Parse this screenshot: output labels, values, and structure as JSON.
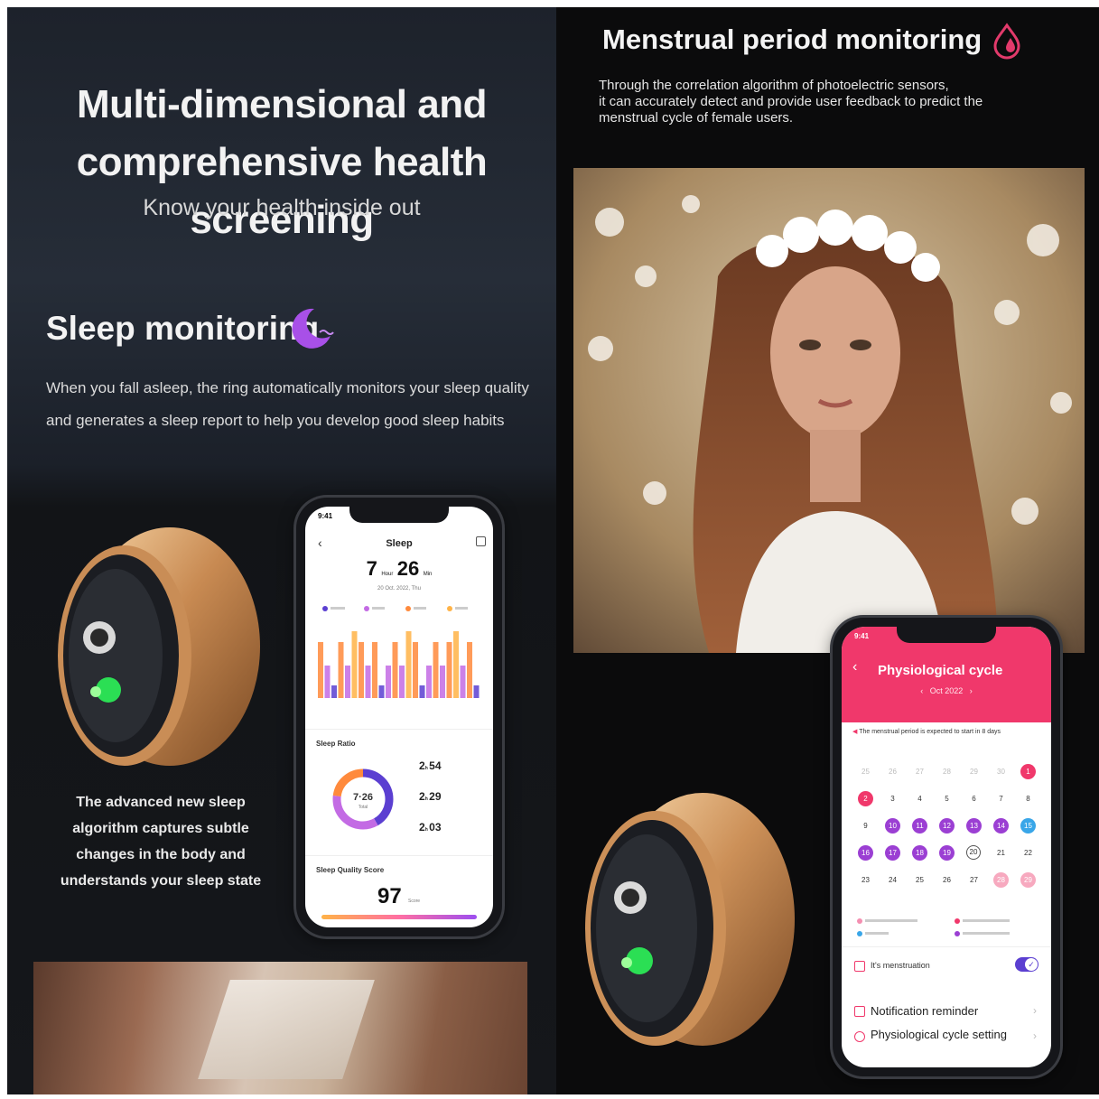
{
  "left": {
    "headline_line1": "Multi-dimensional and",
    "headline_line2": "comprehensive health screening",
    "subheadline": "Know your health inside out",
    "sleep_title": "Sleep monitoring",
    "sleep_desc_line1": "When you fall asleep, the ring automatically monitors your sleep quality",
    "sleep_desc_line2": "and generates a sleep report to help you develop good sleep habits",
    "caption_lines": [
      "The advanced new sleep",
      "algorithm captures subtle",
      "changes in the body and",
      "understands your sleep state"
    ]
  },
  "sleep_app": {
    "status_time": "9:41",
    "title": "Sleep",
    "total_hours": "7",
    "hours_unit": "Hour",
    "total_minutes": "26",
    "minutes_unit": "Min",
    "date": "20 Oct. 2022, Thu",
    "ratio_title": "Sleep Ratio",
    "ratio_center": "7·26",
    "ratio_center_sub": "Total",
    "stage_rows": [
      {
        "hours": "2",
        "minutes": "54"
      },
      {
        "hours": "2",
        "minutes": "29"
      },
      {
        "hours": "2",
        "minutes": "03"
      }
    ],
    "score_title": "Sleep Quality Score",
    "score": "97",
    "score_unit": "Score",
    "colors": {
      "deep": "#5b3fd1",
      "light": "#c36be4",
      "awake": "#ff8a3c",
      "rem": "#ffb347"
    }
  },
  "right": {
    "menstrual_title": "Menstrual period monitoring",
    "menstrual_desc_line1": "Through the correlation algorithm of photoelectric sensors,",
    "menstrual_desc_line2": "it can accurately detect and provide user feedback to predict the",
    "menstrual_desc_line3": "menstrual cycle of female users."
  },
  "cycle_app": {
    "status_time": "9:41",
    "title": "Physiological cycle",
    "month": "Oct 2022",
    "notice": "The menstrual period is expected to start in 8 days",
    "calendar_rows": [
      [
        "25",
        "26",
        "27",
        "28",
        "29",
        "30",
        "1"
      ],
      [
        "2",
        "3",
        "4",
        "5",
        "6",
        "7",
        "8"
      ],
      [
        "9",
        "10",
        "11",
        "12",
        "13",
        "14",
        "15"
      ],
      [
        "16",
        "17",
        "18",
        "19",
        "20",
        "21",
        "22"
      ],
      [
        "23",
        "24",
        "25",
        "26",
        "27",
        "28",
        "29"
      ]
    ],
    "toggle_label": "It's menstruation",
    "menu_items": [
      "Notification reminder",
      "Physiological cycle setting"
    ],
    "colors": {
      "brand": "#f0386b",
      "predicted": "#9b3fd3",
      "ovulation": "#39a6e8"
    }
  }
}
